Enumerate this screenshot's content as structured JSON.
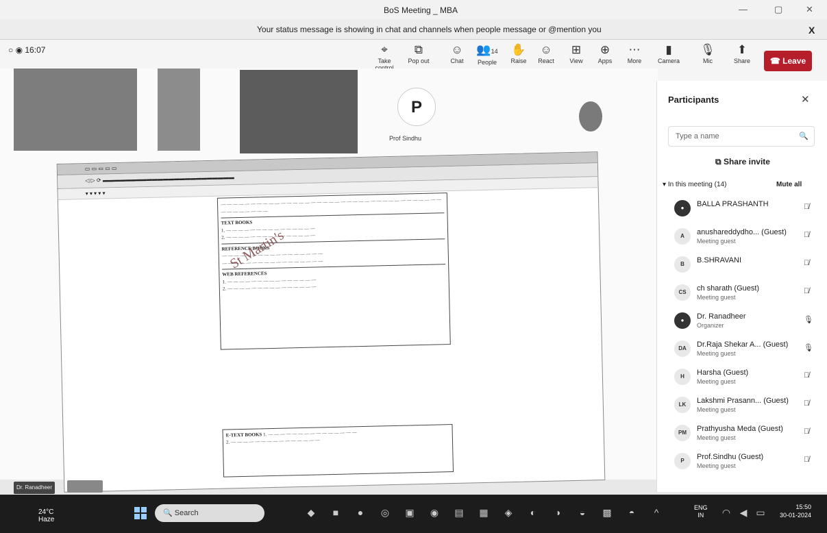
{
  "window": {
    "title": "BoS Meeting _ MBA",
    "minimize": "—",
    "maximize": "▢",
    "close": "✕"
  },
  "banner": {
    "message": "Your status message is showing in chat and channels when people message or @mention you",
    "close": "X"
  },
  "timer": "○ ◉ 16:07",
  "toolbar": {
    "items": [
      {
        "label": "Take control",
        "icon": "hand-pointer-icon",
        "glyph": "⌖"
      },
      {
        "label": "Pop out",
        "icon": "pop-out-icon",
        "glyph": "⧉"
      },
      {
        "label": "Chat",
        "icon": "chat-icon",
        "glyph": "☺"
      },
      {
        "label": "People",
        "icon": "people-icon",
        "glyph": "👥",
        "badge": "14"
      },
      {
        "label": "Raise",
        "icon": "raise-hand-icon",
        "glyph": "✋"
      },
      {
        "label": "React",
        "icon": "react-icon",
        "glyph": "☺"
      },
      {
        "label": "View",
        "icon": "view-icon",
        "glyph": "⊞"
      },
      {
        "label": "Apps",
        "icon": "apps-icon",
        "glyph": "⊕"
      },
      {
        "label": "More",
        "icon": "more-icon",
        "glyph": "⋯"
      },
      {
        "label": "Camera",
        "icon": "camera-icon",
        "glyph": "▮"
      },
      {
        "label": "Mic",
        "icon": "mic-muted-icon",
        "glyph": "🎙"
      },
      {
        "label": "Share",
        "icon": "share-icon",
        "glyph": "⬆"
      }
    ],
    "leave_label": "Leave"
  },
  "stage": {
    "tile_name": "Prof Sindhu"
  },
  "participants_panel": {
    "title": "Participants",
    "search_placeholder": "Type a name",
    "share_invite": "Share invite",
    "in_meeting": "In this meeting (14)",
    "mute_all": "Mute all",
    "people": [
      {
        "initials": "",
        "name": "BALLA PRASHANTH",
        "sub": "",
        "mic": "muted",
        "photo": true
      },
      {
        "initials": "A",
        "name": "anushareddydho... (Guest)",
        "sub": "Meeting guest",
        "mic": "muted",
        "photo": false
      },
      {
        "initials": "B",
        "name": "B.SHRAVANI",
        "sub": "",
        "mic": "muted",
        "photo": false
      },
      {
        "initials": "CS",
        "name": "ch sharath (Guest)",
        "sub": "Meeting guest",
        "mic": "muted",
        "photo": false
      },
      {
        "initials": "",
        "name": "Dr. Ranadheer",
        "sub": "Organizer",
        "mic": "on",
        "photo": true
      },
      {
        "initials": "DA",
        "name": "Dr.Raja Shekar A... (Guest)",
        "sub": "Meeting guest",
        "mic": "on",
        "photo": false
      },
      {
        "initials": "H",
        "name": "Harsha (Guest)",
        "sub": "Meeting guest",
        "mic": "muted",
        "photo": false
      },
      {
        "initials": "LK",
        "name": "Lakshmi Prasann... (Guest)",
        "sub": "Meeting guest",
        "mic": "muted",
        "photo": false
      },
      {
        "initials": "PM",
        "name": "Prathyusha Meda (Guest)",
        "sub": "Meeting guest",
        "mic": "muted",
        "photo": false
      },
      {
        "initials": "P",
        "name": "Prof.Sindhu (Guest)",
        "sub": "Meeting guest",
        "mic": "muted",
        "photo": false
      }
    ]
  },
  "shared_screen": {
    "text_books_heading": "TEXT BOOKS",
    "references_heading": "REFERENCE BOOKS",
    "web_references_heading": "WEB REFERENCES",
    "e_text_books_heading": "E-TEXT BOOKS",
    "watermark": "St Martin's"
  },
  "stage_footer_name": "Dr. Ranadheer",
  "taskbar": {
    "weather_temp": "24°C",
    "weather_desc": "Haze",
    "search_label": "Search",
    "lang": "ENG",
    "region": "IN",
    "time": "15:50",
    "date": "30-01-2024"
  },
  "colors": {
    "leave": "#b51e2a",
    "taskbar": "#1c1c1c"
  }
}
